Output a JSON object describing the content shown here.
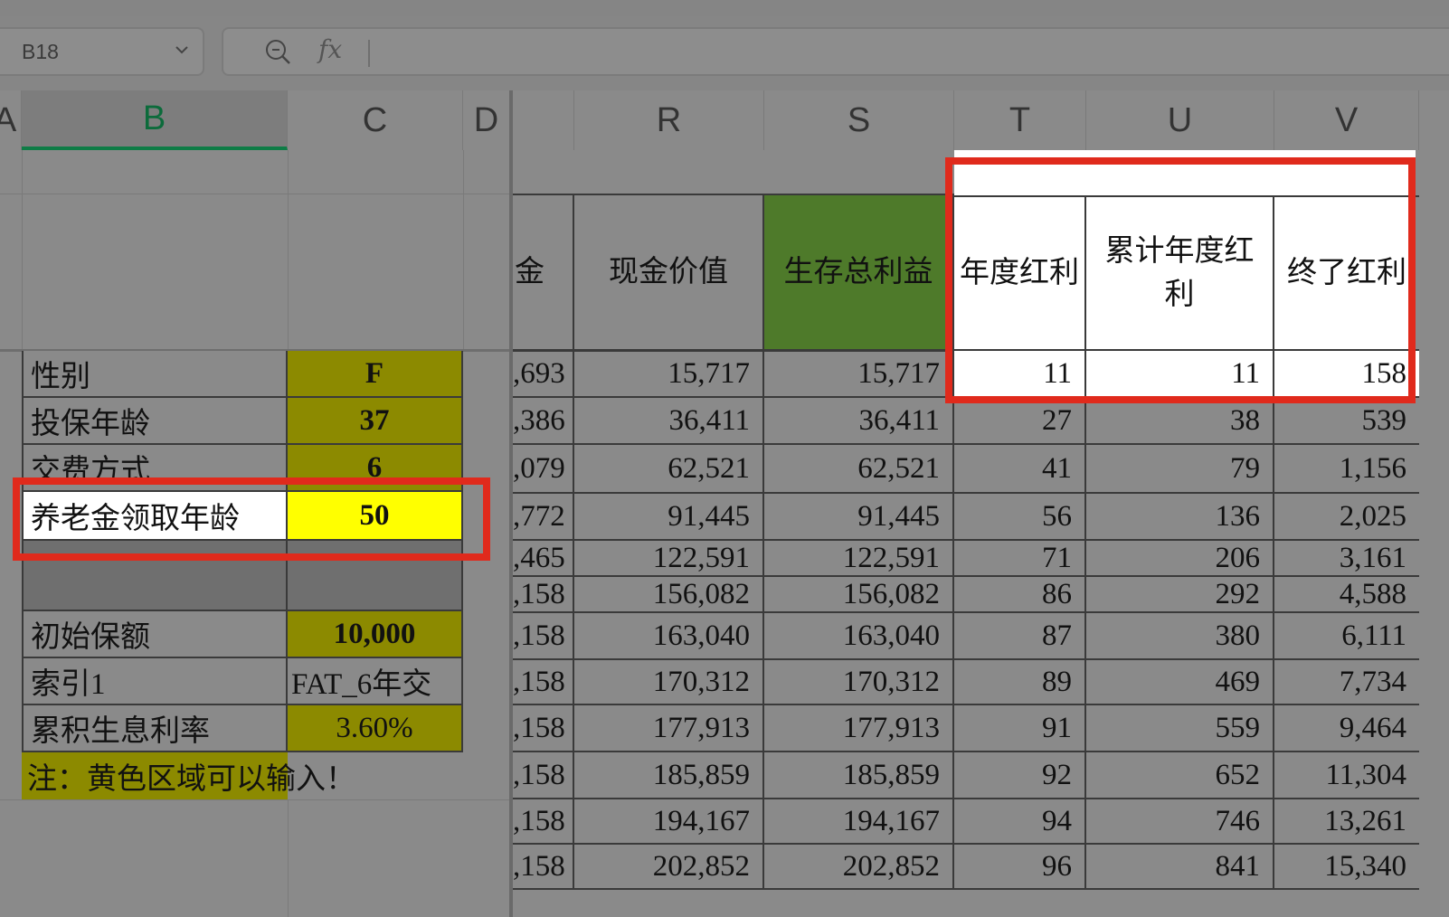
{
  "formula_bar": {
    "cell_ref": "B18",
    "fx_label": "fx"
  },
  "columns": [
    "A",
    "B",
    "C",
    "D",
    "R",
    "S",
    "T",
    "U",
    "V"
  ],
  "params": [
    {
      "label": "性别",
      "value": "F",
      "style": "olive"
    },
    {
      "label": "投保年龄",
      "value": "37",
      "style": "olive"
    },
    {
      "label": "交费方式",
      "value": "6",
      "style": "olive"
    },
    {
      "label": "养老金领取年龄",
      "value": "50",
      "style": "yellow"
    },
    {
      "label": "",
      "value": "",
      "style": "gray"
    },
    {
      "label": "初始保额",
      "value": "10,000",
      "style": "olive"
    },
    {
      "label": "索引1",
      "value": "FAT_6年交",
      "style": "plain"
    },
    {
      "label": "累积生息利率",
      "value": "3.60%",
      "style": "olive"
    }
  ],
  "note": "注：黄色区域可以输入！",
  "table_headers": {
    "partial": "金",
    "r": "现金价值",
    "s": "生存总利益",
    "t": "年度红利",
    "u": "累计年度红利",
    "v": "终了红利"
  },
  "rows": [
    {
      "p": ",693",
      "r": "15,717",
      "s": "15,717",
      "t": "11",
      "u": "11",
      "v": "158"
    },
    {
      "p": ",386",
      "r": "36,411",
      "s": "36,411",
      "t": "27",
      "u": "38",
      "v": "539"
    },
    {
      "p": ",079",
      "r": "62,521",
      "s": "62,521",
      "t": "41",
      "u": "79",
      "v": "1,156"
    },
    {
      "p": ",772",
      "r": "91,445",
      "s": "91,445",
      "t": "56",
      "u": "136",
      "v": "2,025"
    },
    {
      "p": ",465",
      "r": "122,591",
      "s": "122,591",
      "t": "71",
      "u": "206",
      "v": "3,161"
    },
    {
      "p": ",158",
      "r": "156,082",
      "s": "156,082",
      "t": "86",
      "u": "292",
      "v": "4,588"
    },
    {
      "p": ",158",
      "r": "163,040",
      "s": "163,040",
      "t": "87",
      "u": "380",
      "v": "6,111"
    },
    {
      "p": ",158",
      "r": "170,312",
      "s": "170,312",
      "t": "89",
      "u": "469",
      "v": "7,734"
    },
    {
      "p": ",158",
      "r": "177,913",
      "s": "177,913",
      "t": "91",
      "u": "559",
      "v": "9,464"
    },
    {
      "p": ",158",
      "r": "185,859",
      "s": "185,859",
      "t": "92",
      "u": "652",
      "v": "11,304"
    },
    {
      "p": ",158",
      "r": "194,167",
      "s": "194,167",
      "t": "94",
      "u": "746",
      "v": "13,261"
    },
    {
      "p": ",158",
      "r": "202,852",
      "s": "202,852",
      "t": "96",
      "u": "841",
      "v": "15,340"
    }
  ],
  "colors": {
    "olive": "#8c8a00",
    "yellow": "#ffff00",
    "green_header": "#4e7a2a",
    "highlight": "#e02a1c"
  }
}
